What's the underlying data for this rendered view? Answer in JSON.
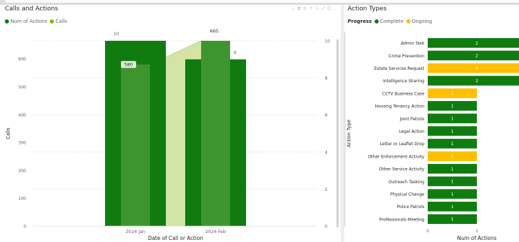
{
  "left_visual": {
    "title": "Calls and Actions",
    "legend": [
      {
        "label": "Num of Actions",
        "color": "#107c10"
      },
      {
        "label": "Calls",
        "color": "#7fba00"
      }
    ],
    "toolbar_icons": [
      "pin-icon",
      "copy-icon",
      "filter-icon",
      "drill-up-icon",
      "drill-down-icon",
      "expand-icon",
      "focus-mode-icon",
      "more-options-icon"
    ]
  },
  "right_visual": {
    "title": "Action Types",
    "legend_title": "Progress",
    "legend": [
      {
        "label": "Complete",
        "color": "#107c10"
      },
      {
        "label": "Ongoing",
        "color": "#ffc000"
      }
    ]
  },
  "chart_data": [
    {
      "type": "bar",
      "title": "Calls and Actions",
      "xlabel": "Date of Call or Action",
      "ylabel": "Calls",
      "categories": [
        "2024 Jan",
        "2024 Feb"
      ],
      "ylim": [
        0,
        665
      ],
      "y2lim": [
        0,
        10
      ],
      "left_ticks": [
        0,
        100,
        200,
        300,
        400,
        500,
        600
      ],
      "right_ticks": [
        0,
        2,
        4,
        6,
        8,
        10
      ],
      "series": [
        {
          "name": "Num of Actions",
          "axis": "right",
          "values": [
            10,
            9
          ],
          "color": "#107c10"
        },
        {
          "name": "Calls",
          "axis": "left",
          "values": [
            580,
            665
          ],
          "color": "#3e952f"
        }
      ],
      "data_labels": {
        "actions": [
          "10",
          "9"
        ],
        "calls": [
          "580",
          "665"
        ]
      },
      "grid": true
    },
    {
      "type": "bar",
      "orientation": "horizontal",
      "title": "Action Types",
      "xlabel": "Num of Actions",
      "ylabel": "Action Type",
      "xticks": [
        0,
        1
      ],
      "categories": [
        "Admin Task",
        "Crime Prevention",
        "Estate Services Request",
        "Intelligence Sharing",
        "CCTV Business Case",
        "Housing Tenancy Action",
        "Joint Patrols",
        "Legal Action",
        "Letter or Leaflet Drop",
        "Other Enforcement Activity",
        "Other Service Activity",
        "Outreach Tasking",
        "Physical Change",
        "Police Patrols",
        "Professionals Meeting"
      ],
      "values": [
        2,
        2,
        2,
        2,
        1,
        1,
        1,
        1,
        1,
        1,
        1,
        1,
        1,
        1,
        1
      ],
      "progress": [
        "Complete",
        "Complete",
        "Ongoing",
        "Complete",
        "Ongoing",
        "Complete",
        "Complete",
        "Complete",
        "Complete",
        "Ongoing",
        "Complete",
        "Complete",
        "Complete",
        "Complete",
        "Complete"
      ],
      "colors": {
        "Complete": "#107c10",
        "Ongoing": "#ffc000"
      },
      "grid": true
    }
  ]
}
